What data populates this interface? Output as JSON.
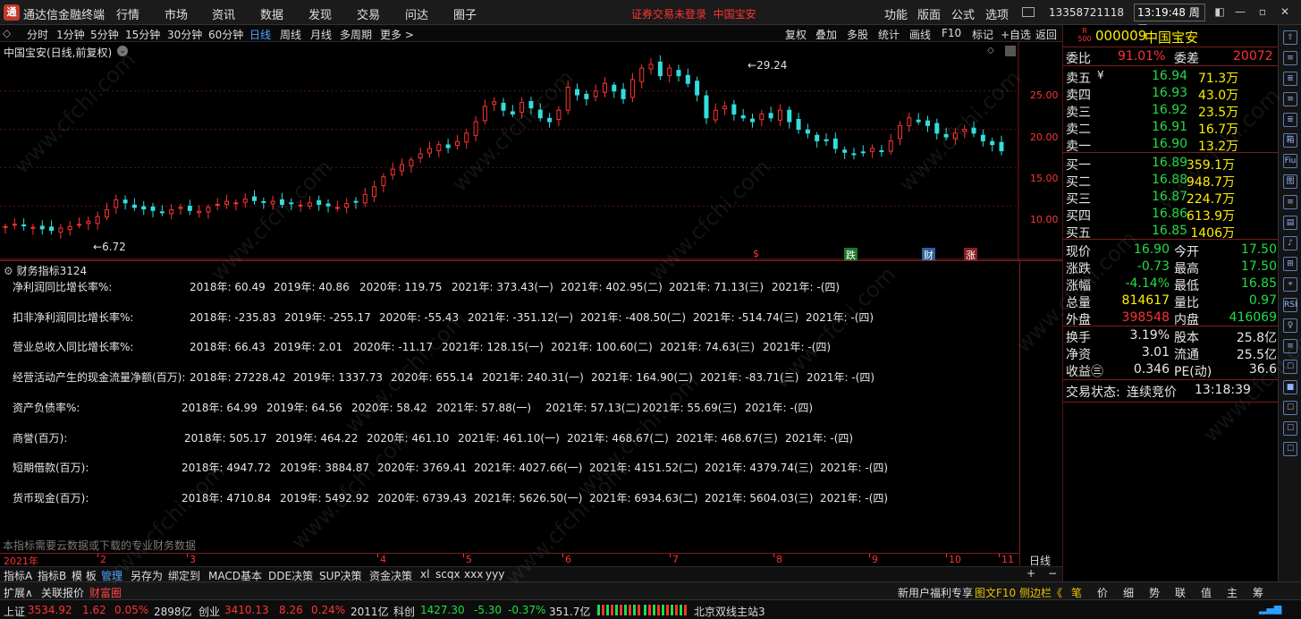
{
  "titlebar": {
    "app_name": "通达信金融终端",
    "menus": [
      "行情",
      "市场",
      "资讯",
      "数据",
      "发现",
      "交易",
      "问达",
      "圈子"
    ],
    "warning": "证券交易未登录",
    "stock_tag": "中国宝安",
    "right_menus": [
      "功能",
      "版面",
      "公式",
      "选项"
    ],
    "phone": "13358721118",
    "clock": "13:19:48 周二"
  },
  "periodbar": {
    "items": [
      "分时",
      "1分钟",
      "5分钟",
      "15分钟",
      "30分钟",
      "60分钟",
      "日线",
      "周线",
      "月线",
      "多周期",
      "更多 >"
    ],
    "active": "日线",
    "right_items": [
      "复权",
      "叠加",
      "多股",
      "统计",
      "画线",
      "F10",
      "标记",
      "+自选",
      "返回"
    ]
  },
  "chart": {
    "title": "中国宝安(日线,前复权)",
    "high_label": "29.24",
    "low_label": "6.72",
    "y_ticks": [
      "25.00",
      "20.00",
      "15.00",
      "10.00"
    ],
    "markers": [
      {
        "text": "$",
        "color": "#ff3333"
      },
      {
        "text": "跌",
        "color": "#22cc44"
      },
      {
        "text": "财",
        "color": "#4da3ff"
      },
      {
        "text": "涨",
        "color": "#ff3333"
      }
    ]
  },
  "chart_data": {
    "type": "candlestick",
    "title": "中国宝安(日线,前复权)",
    "ylim": [
      5,
      30
    ],
    "y_ticks": [
      10,
      15,
      20,
      25
    ],
    "x_months": [
      "2021年",
      "2",
      "3",
      "4",
      "5",
      "6",
      "7",
      "8",
      "9",
      "10",
      "11"
    ],
    "high": 29.24,
    "low": 6.72,
    "closes": [
      7.3,
      7.6,
      7.4,
      7.2,
      7.0,
      6.8,
      7.1,
      7.3,
      7.6,
      8.0,
      8.6,
      9.5,
      10.8,
      10.4,
      9.8,
      9.6,
      9.4,
      9.2,
      9.5,
      9.8,
      9.4,
      9.3,
      9.8,
      10.2,
      10.6,
      10.4,
      10.9,
      10.7,
      10.5,
      10.6,
      10.2,
      10.3,
      10.1,
      10.4,
      10.2,
      10.0,
      9.8,
      10.3,
      10.5,
      11.5,
      12.5,
      13.8,
      14.8,
      15.4,
      16.0,
      16.8,
      17.5,
      18.0,
      17.6,
      18.4,
      19.5,
      21.0,
      23.0,
      23.6,
      22.5,
      22.0,
      23.5,
      22.8,
      21.5,
      21.0,
      22.5,
      25.5,
      24.5,
      24.0,
      25.0,
      26.0,
      25.0,
      24.0,
      26.5,
      28.0,
      28.5,
      27.0,
      28.0,
      27.0,
      26.0,
      24.5,
      21.5,
      22.5,
      23.0,
      22.0,
      21.5,
      21.0,
      22.0,
      21.5,
      22.5,
      21.0,
      20.0,
      19.5,
      18.5,
      18.5,
      17.5,
      17.0,
      16.8,
      17.0,
      17.5,
      17.2,
      18.5,
      20.5,
      21.5,
      21.0,
      20.5,
      19.5,
      19.0,
      19.5,
      20.0,
      19.5,
      18.5,
      18.0,
      17.2
    ]
  },
  "indicator": {
    "title": "财务指标3124",
    "rows": [
      {
        "label": "净利润同比增长率%:",
        "values": [
          "2018年: 60.49",
          "2019年: 40.86",
          "2020年: 119.75",
          "2021年: 373.43(一)",
          "2021年: 402.95(二)",
          "2021年: 71.13(三)",
          "2021年: -(四)"
        ]
      },
      {
        "label": "扣非净利润同比增长率%:",
        "values": [
          "2018年: -235.83",
          "2019年: -255.17",
          "2020年: -55.43",
          "2021年: -351.12(一)",
          "2021年: -408.50(二)",
          "2021年: -514.74(三)",
          "2021年: -(四)"
        ]
      },
      {
        "label": "营业总收入同比增长率%:",
        "values": [
          "2018年: 66.43",
          "2019年: 2.01",
          "2020年: -11.17",
          "2021年: 128.15(一)",
          "2021年: 100.60(二)",
          "2021年: 74.63(三)",
          "2021年: -(四)"
        ]
      },
      {
        "label": "经营活动产生的现金流量净额(百万):",
        "values": [
          "2018年: 27228.42",
          "2019年: 1337.73",
          "2020年: 655.14",
          "2021年: 240.31(一)",
          "2021年: 164.90(二)",
          "2021年: -83.71(三)",
          "2021年: -(四)"
        ]
      },
      {
        "label": "资产负债率%:",
        "values": [
          "2018年: 64.99",
          "2019年: 64.56",
          "2020年: 58.42",
          "2021年: 57.88(一)",
          "2021年: 57.13(二)",
          "2021年: 55.69(三)",
          "2021年: -(四)"
        ]
      },
      {
        "label": "商誉(百万):",
        "values": [
          "2018年: 505.17",
          "2019年: 464.22",
          "2020年: 461.10",
          "2021年: 461.10(一)",
          "2021年: 468.67(二)",
          "2021年: 468.67(三)",
          "2021年: -(四)"
        ]
      },
      {
        "label": "短期借款(百万):",
        "values": [
          "2018年: 4947.72",
          "2019年: 3884.87",
          "2020年: 3769.41",
          "2021年: 4027.66(一)",
          "2021年: 4151.52(二)",
          "2021年: 4379.74(三)",
          "2021年: -(四)"
        ]
      },
      {
        "label": "货币现金(百万):",
        "values": [
          "2018年: 4710.84",
          "2019年: 5492.92",
          "2020年: 6739.43",
          "2021年: 5626.50(一)",
          "2021年: 6934.63(二)",
          "2021年: 5604.03(三)",
          "2021年: -(四)"
        ]
      }
    ],
    "note": "本指标需要云数据或下载的专业财务数据",
    "period_label": "日线"
  },
  "axis": {
    "months": [
      "2021年",
      "2",
      "3",
      "4",
      "5",
      "6",
      "7",
      "8",
      "9",
      "10",
      "11"
    ]
  },
  "quote": {
    "badge_top": "R",
    "badge_bottom": "500",
    "code": "000009",
    "name": "中国宝安",
    "weibi_label": "委比",
    "weibi": "91.01%",
    "weicha_label": "委差",
    "weicha": "20072",
    "asks": [
      {
        "label": "卖五",
        "price": "16.94",
        "vol": "71.3万"
      },
      {
        "label": "卖四",
        "price": "16.93",
        "vol": "43.0万"
      },
      {
        "label": "卖三",
        "price": "16.92",
        "vol": "23.5万"
      },
      {
        "label": "卖二",
        "price": "16.91",
        "vol": "16.7万"
      },
      {
        "label": "卖一",
        "price": "16.90",
        "vol": "13.2万"
      }
    ],
    "ask5_mark": "¥",
    "bids": [
      {
        "label": "买一",
        "price": "16.89",
        "vol": "359.1万"
      },
      {
        "label": "买二",
        "price": "16.88",
        "vol": "948.7万"
      },
      {
        "label": "买三",
        "price": "16.87",
        "vol": "224.7万"
      },
      {
        "label": "买四",
        "price": "16.86",
        "vol": "613.9万"
      },
      {
        "label": "买五",
        "price": "16.85",
        "vol": "1406万"
      }
    ],
    "stats_left": [
      {
        "label": "现价",
        "value": "16.90",
        "color": "green"
      },
      {
        "label": "涨跌",
        "value": "-0.73",
        "color": "green"
      },
      {
        "label": "涨幅",
        "value": "-4.14%",
        "color": "green"
      },
      {
        "label": "总量",
        "value": "814617",
        "color": "yellow"
      },
      {
        "label": "外盘",
        "value": "398548",
        "color": "red"
      }
    ],
    "stats_right": [
      {
        "label": "今开",
        "value": "17.50",
        "color": "green"
      },
      {
        "label": "最高",
        "value": "17.50",
        "color": "green"
      },
      {
        "label": "最低",
        "value": "16.85",
        "color": "green"
      },
      {
        "label": "量比",
        "value": "0.97",
        "color": "green"
      },
      {
        "label": "内盘",
        "value": "416069",
        "color": "green"
      }
    ],
    "fund_left": [
      {
        "label": "换手",
        "value": "3.19%"
      },
      {
        "label": "净资",
        "value": "3.01"
      },
      {
        "label": "收益㊂",
        "value": "0.346"
      }
    ],
    "fund_right": [
      {
        "label": "股本",
        "value": "25.8亿"
      },
      {
        "label": "流通",
        "value": "25.5亿"
      },
      {
        "label": "PE(动)",
        "value": "36.6"
      }
    ],
    "trade_status_label": "交易状态:",
    "trade_status": "连续竞价",
    "trade_time": "13:18:39"
  },
  "right_toolbar": [
    "⇧",
    "≡",
    "≣",
    "≡",
    "≣",
    "箱",
    "Fiu",
    "图",
    "≡",
    "▤",
    "♪",
    "⊞",
    "⌖",
    "RSI",
    "♀",
    "≡",
    "☐",
    "■",
    "☐",
    "☐",
    "☐"
  ],
  "bottom_tools": [
    "指标A",
    "指标B",
    "模 板",
    "管理",
    "另存为",
    "绑定到",
    "MACD基本",
    "DDE决策",
    "SUP决策",
    "资金决策",
    "xl",
    "scqx",
    "xxx",
    "yyy"
  ],
  "bottom_plusminus": [
    "+",
    "−"
  ],
  "bar2": {
    "left": [
      "扩展∧",
      "关联报价",
      "财富圈"
    ],
    "right": [
      "新用户福利专享",
      "图文F10",
      "侧边栏《"
    ],
    "tabs": [
      "笔",
      "价",
      "细",
      "势",
      "联",
      "值",
      "主",
      "筹"
    ]
  },
  "status": {
    "sh_label": "上证",
    "sh_val": "3534.92",
    "sh_chg": "1.62",
    "sh_pct": "0.05%",
    "sh_amt": "2898亿",
    "cy_label": "创业",
    "cy_val": "3410.13",
    "cy_chg": "8.26",
    "cy_pct": "0.24%",
    "cy_amt": "2011亿",
    "kc_label": "科创",
    "kc_val": "1427.30",
    "kc_chg": "-5.30",
    "kc_pct": "-0.37%",
    "kc_amt": "351.7亿",
    "server": "北京双线主站3"
  },
  "watermark": "www.cfchi.com"
}
